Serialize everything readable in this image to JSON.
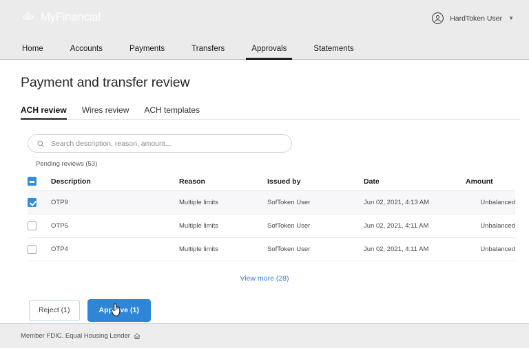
{
  "header": {
    "brand_name": "MyFinancial",
    "brand_mark_icon": "lotus-logo-icon",
    "user_name": "HardToken User",
    "avatar_icon": "user-avatar-icon",
    "caret_icon": "chevron-down-icon",
    "background_color": "#ebebeb",
    "nav": [
      {
        "label": "Home",
        "active": false
      },
      {
        "label": "Accounts",
        "active": false
      },
      {
        "label": "Payments",
        "active": false
      },
      {
        "label": "Transfers",
        "active": false
      },
      {
        "label": "Approvals",
        "active": true
      },
      {
        "label": "Statements",
        "active": false
      }
    ]
  },
  "main": {
    "page_title": "Payment and transfer review",
    "subtabs": [
      {
        "label": "ACH review",
        "active": true
      },
      {
        "label": "Wires review",
        "active": false
      },
      {
        "label": "ACH templates",
        "active": false
      }
    ],
    "search": {
      "placeholder": "Search description, reason, amount...",
      "value": "",
      "icon": "search-icon"
    },
    "pending_label": "Pending reviews (53)",
    "table": {
      "select_all_state": "indeterminate",
      "columns": [
        "Description",
        "Reason",
        "Issued by",
        "Date",
        "Amount"
      ],
      "rows": [
        {
          "checked": true,
          "description": "OTP9",
          "reason": "Multiple limits",
          "issued_by": "SofToken User",
          "date": "Jun 02, 2021, 4:13 AM",
          "amount": "Unbalanced"
        },
        {
          "checked": false,
          "description": "OTP5",
          "reason": "Multiple limits",
          "issued_by": "SofToken User",
          "date": "Jun 02, 2021, 4:11 AM",
          "amount": "Unbalanced"
        },
        {
          "checked": false,
          "description": "OTP4",
          "reason": "Multiple limits",
          "issued_by": "SofToken User",
          "date": "Jun 02, 2021, 4:11 AM",
          "amount": "Unbalanced"
        }
      ],
      "view_more_label": "View more (28)"
    },
    "actions": {
      "reject_label": "Reject (1)",
      "approve_label": "Approve (1)",
      "approve_color": "#2f86d6",
      "cursor_icon": "pointing-hand-cursor-icon"
    }
  },
  "footer": {
    "text": "Member FDIC.  Equal Housing Lender",
    "icon": "equal-housing-lender-icon",
    "background_color": "#ededed"
  }
}
